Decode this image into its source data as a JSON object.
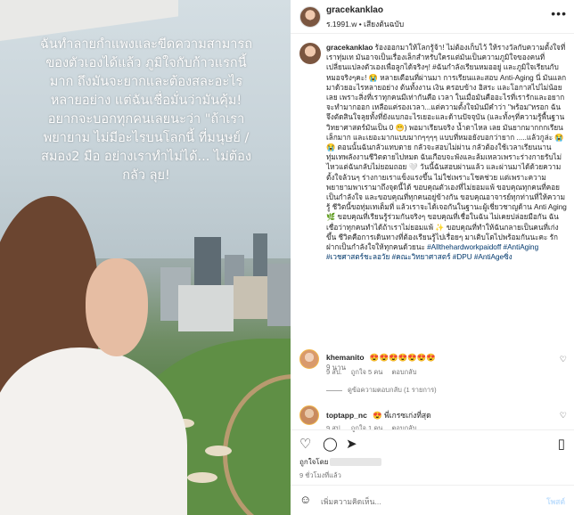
{
  "media": {
    "overlay_lines": [
      "ฉันทำลายกำแพงและขีดความสามารถ",
      "ของตัวเองได้แล้ว ภูมิใจกับก้าวแรกนี้",
      "มาก ถึงมันจะยากและต้องสละอะไร",
      "หลายอย่าง แต่ฉันเชื่อมั่นว่ามันคุ้ม!",
      "อยากจะบอกทุกคนเลยนะว่า \"ถ้าเรา",
      "พยายาม ไม่มีอะไรบนโลกนี้ ที่มนุษย์ /",
      "สมอง2 มือ อย่างเราทำไม่ได้... ไม่ต้อง",
      "กลัว ลุย!"
    ]
  },
  "header": {
    "username": "gracekanklao",
    "subtitle": "ร.1991.w • เสียงต้นฉบับ",
    "more_icon": "more-horizontal-icon"
  },
  "caption": {
    "username": "gracekanklao",
    "text": "ร้องออกมาให้โลกรู้จ้า! ไม่ต้องเก็บไว้ ให้รางวัลกับความตั้งใจที่เราทุ่มเท มันอาจเป็นเรื่องเล็กสำหรับใครแต่มันเป็นความภูมิใจของคนที่เปลี่ยนแปลงตัวเองเพื่อลูกได้จริงๆ! #ฉันกำลังเรียนหมออยู่ และภูมิใจเรียนกับหมอจริงๆคะ! 😭 หลายเดือนที่ผ่านมา การเรียนและสอบ Anti-Aging นี่ มันแลกมาด้วยอะไรหลายอย่าง ต้นทั้งงาน เงิน ครอบข้าง อิสระ และโอกาสไปไม่น้อยเลย เพราะสิ่งที่เราทุกคนมีเท่ากันคือ เวลา ในเมื่อมันคืออะไรที่เรารักและอยากจะทำมากออก เหลือแค่รองเวลา...แต่ความตั้งใจมันมีคำว่า \"พร้อม\"หรอก ฉันจึงตัดสินใจลุยทั้งที่ยังแบกอะไรเยอะและด้านปัจจุบัน (และทั้งๆที่ความรู้พื้นฐานวิทยาศาสตร์มันเป็น 0 😬) พอมาเรียนจริง น้ำตาไหล เลย มันยากมากกกเรียนเล็กมาก และเยอะมากแบบมากๆๆๆๆ แบบที่หมอยังบอกว่ายาก .....แล้วกูล่ะ 😭😭 ตอนนั้นฉันกลัวแทบตาย กลัวจะสอบไม่ผ่าน กลัวต้องใช้เวลาเรียนนานทุ่มเทพลังงานชีวิตตายไปหมด ฉันเกือบจะพังและล้มเหลวเพราะร่างกายรับไม่ไหวแต่ฉันกลับไม่ยอมถอย 🤍 วันนี้ฉันสอบผ่านแล้ว และผ่านมาได้ด้วยความตั้งใจล้วนๆ ร่างกายเราแข็งแรงขึ้น ไม่ใช่เพราะโชคช่วย แต่เพราะความพยายามพาเรามาถึงจุดนี้ได้ ขอบคุณตัวเองที่ไม่ยอมแพ้ ขอบคุณทุกคนที่คอยเป็นกำลังใจ และขอบคุณที่ทุกคนอยู่ข้างกัน ขอบคุณอาจารย์ทุกท่านที่ให้ความรู้ ชีวิตนี้ขอทุ่มเทเต็มที่ แล้วเราจะได้เจอกันในฐานะผู้เชี่ยวชาญด้าน Anti Aging 🌿 ขอบคุณที่เรียนรู้ร่วมกันจริงๆ ขอบคุณที่เชื่อในฉัน ไม่เคยปล่อยมือกัน ฉันเชื่อว่าทุกคนทำได้ถ้าเราไม่ยอมแพ้ ✨ ขอบคุณที่ทำให้ฉันกลายเป็นคนที่เก่งขึ้น ชีวิตคือการเดินทางที่ต้องเรียนรู้ไปเรื่อยๆ มาเติบโตไปพร้อมกันนะคะ รัก ฝากเป็นกำลังใจให้ทุกคนด้วยนะ",
    "hashtags": "#Allthehardworkpaidoff #AntiAging #เวชศาสตร์ชะลอวัย #คณะวิทยาศาสตร์ #DPU #AntiAgeซิ่ง",
    "time": "9 นาน"
  },
  "comments": [
    {
      "username": "khemanito",
      "text": "😍😍😍😍😍😍😍",
      "time": "9 สป.",
      "likes": "ถูกใจ 5 คน",
      "reply": "ตอบกลับ",
      "view_replies": "ดูข้อความตอบกลับ (1 รายการ)"
    },
    {
      "username": "toptapp_nc",
      "text": "😍 พี่เกรซเก่งที่สุด",
      "time": "9 สป.",
      "likes": "ถูกใจ 1 คน",
      "reply": "ตอบกลับ"
    }
  ],
  "actions": {
    "like_icon": "heart-icon",
    "comment_icon": "comment-icon",
    "share_icon": "share-icon",
    "save_icon": "bookmark-icon"
  },
  "likes_line": {
    "prefix": "ถูกใจโดย"
  },
  "post_time": "9 ชั่วโมงที่แล้ว",
  "add_comment": {
    "placeholder": "เพิ่มความคิดเห็น...",
    "post_label": "โพสต์"
  }
}
